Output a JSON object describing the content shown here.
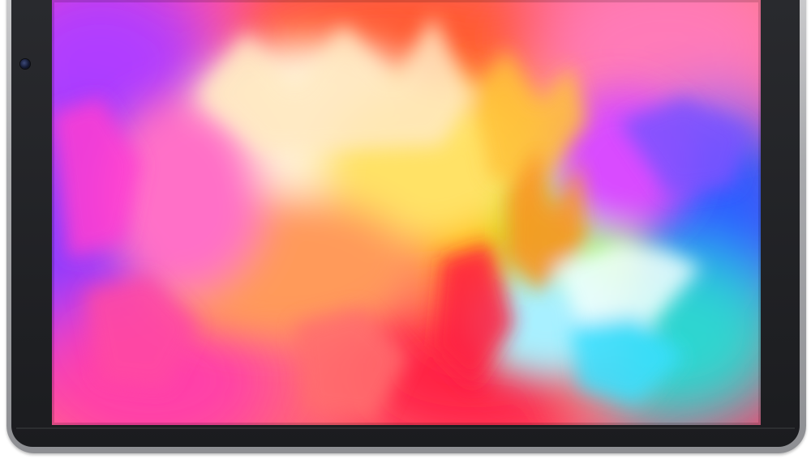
{
  "device": {
    "type": "tablet",
    "frame_color": "#a9aaad",
    "bezel_color": "#1c1d20",
    "camera_icon": "front-camera-icon"
  },
  "wallpaper": {
    "style": "abstract colorful exploding paint",
    "palette": [
      "#ff2d6f",
      "#ff8a3d",
      "#ffd23a",
      "#fff3c8",
      "#b44dff",
      "#3a7bff",
      "#2de0d0",
      "#ff3bd0"
    ]
  }
}
